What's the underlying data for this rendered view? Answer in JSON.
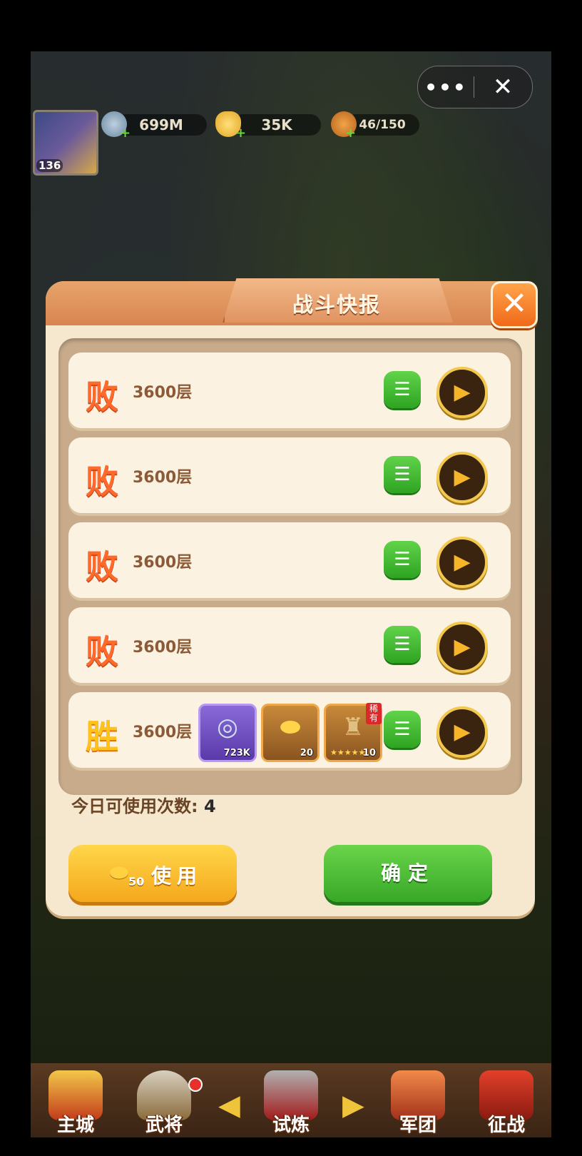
{
  "top_bar": {
    "more_icon": "more-dots-icon",
    "close_icon": "close-icon"
  },
  "player": {
    "level": "136"
  },
  "resources": [
    {
      "icon": "coin-icon",
      "value": "699M"
    },
    {
      "icon": "gold-ingot-icon",
      "value": "35K"
    },
    {
      "icon": "food-icon",
      "value": "46/150"
    }
  ],
  "dialog": {
    "title": "战斗快报",
    "close_label": "✕",
    "records": [
      {
        "result": "败",
        "floor": "3600层",
        "rewards": []
      },
      {
        "result": "败",
        "floor": "3600层",
        "rewards": []
      },
      {
        "result": "败",
        "floor": "3600层",
        "rewards": []
      },
      {
        "result": "败",
        "floor": "3600层",
        "rewards": []
      },
      {
        "result": "胜",
        "floor": "3600层",
        "rewards": [
          {
            "icon": "silver-coin-icon",
            "count": "723K"
          },
          {
            "icon": "gold-ingot-icon",
            "count": "20"
          },
          {
            "icon": "hero-helmet-icon",
            "count": "10",
            "tag": "稀有",
            "stars": 5
          }
        ]
      }
    ],
    "uses_label": "今日可使用次数:",
    "uses_value": "4",
    "use_button": {
      "cost": "50",
      "label": "使用"
    },
    "confirm_button": {
      "label": "确定"
    }
  },
  "nav": [
    {
      "label": "主城"
    },
    {
      "label": "武将"
    },
    {
      "label": "试炼"
    },
    {
      "label": "军团"
    },
    {
      "label": "征战"
    }
  ],
  "colors": {
    "panel": "#f6e8cf",
    "header": "#d88550",
    "green_button": "#38a828",
    "yellow_button": "#f5a81c"
  }
}
